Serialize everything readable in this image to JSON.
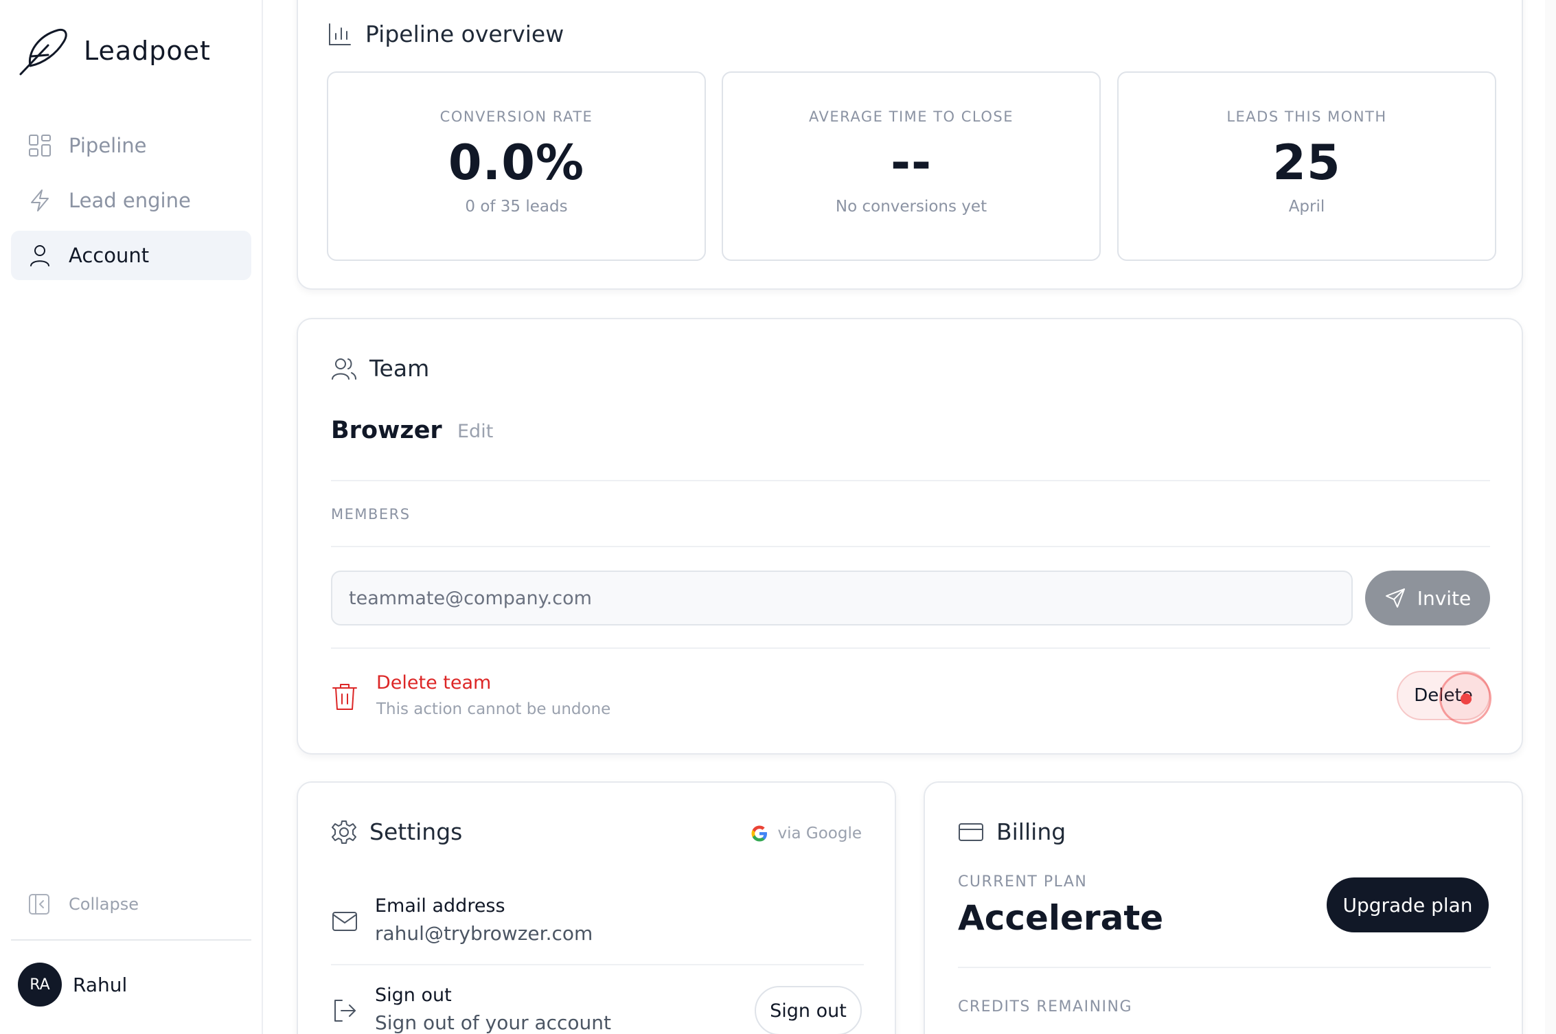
{
  "brand": {
    "name": "Leadpoet",
    "logo_icon": "feather-icon"
  },
  "sidebar": {
    "items": [
      {
        "label": "Pipeline",
        "icon": "grid-icon",
        "active": false
      },
      {
        "label": "Lead engine",
        "icon": "bolt-icon",
        "active": false
      },
      {
        "label": "Account",
        "icon": "user-icon",
        "active": true
      }
    ],
    "collapse_label": "Collapse",
    "user": {
      "initials": "RA",
      "name": "Rahul"
    }
  },
  "pipeline": {
    "title": "Pipeline overview",
    "stats": [
      {
        "label": "CONVERSION RATE",
        "value": "0.0%",
        "sub": "0 of 35 leads"
      },
      {
        "label": "AVERAGE TIME TO CLOSE",
        "value": "--",
        "sub": "No conversions yet"
      },
      {
        "label": "LEADS THIS MONTH",
        "value": "25",
        "sub": "April"
      }
    ]
  },
  "team": {
    "title": "Team",
    "name": "Browzer",
    "edit_label": "Edit",
    "members_label": "MEMBERS",
    "invite_placeholder": "teammate@company.com",
    "invite_label": "Invite",
    "danger": {
      "title": "Delete team",
      "subtitle": "This action cannot be undone",
      "button_label": "Delete"
    }
  },
  "settings": {
    "title": "Settings",
    "auth_provider": "via Google",
    "email_title": "Email address",
    "email_value": "rahul@trybrowzer.com",
    "signout_title": "Sign out",
    "signout_sub": "Sign out of your account",
    "signout_button": "Sign out"
  },
  "billing": {
    "title": "Billing",
    "plan_label": "CURRENT PLAN",
    "plan_name": "Accelerate",
    "upgrade_label": "Upgrade plan",
    "credits_label": "CREDITS REMAINING"
  },
  "colors": {
    "accent_dark": "#111827",
    "danger": "#dc2626",
    "muted": "#8b93a3",
    "active_nav_bg": "#f1f4f9",
    "invite_button": "#8e939b"
  }
}
